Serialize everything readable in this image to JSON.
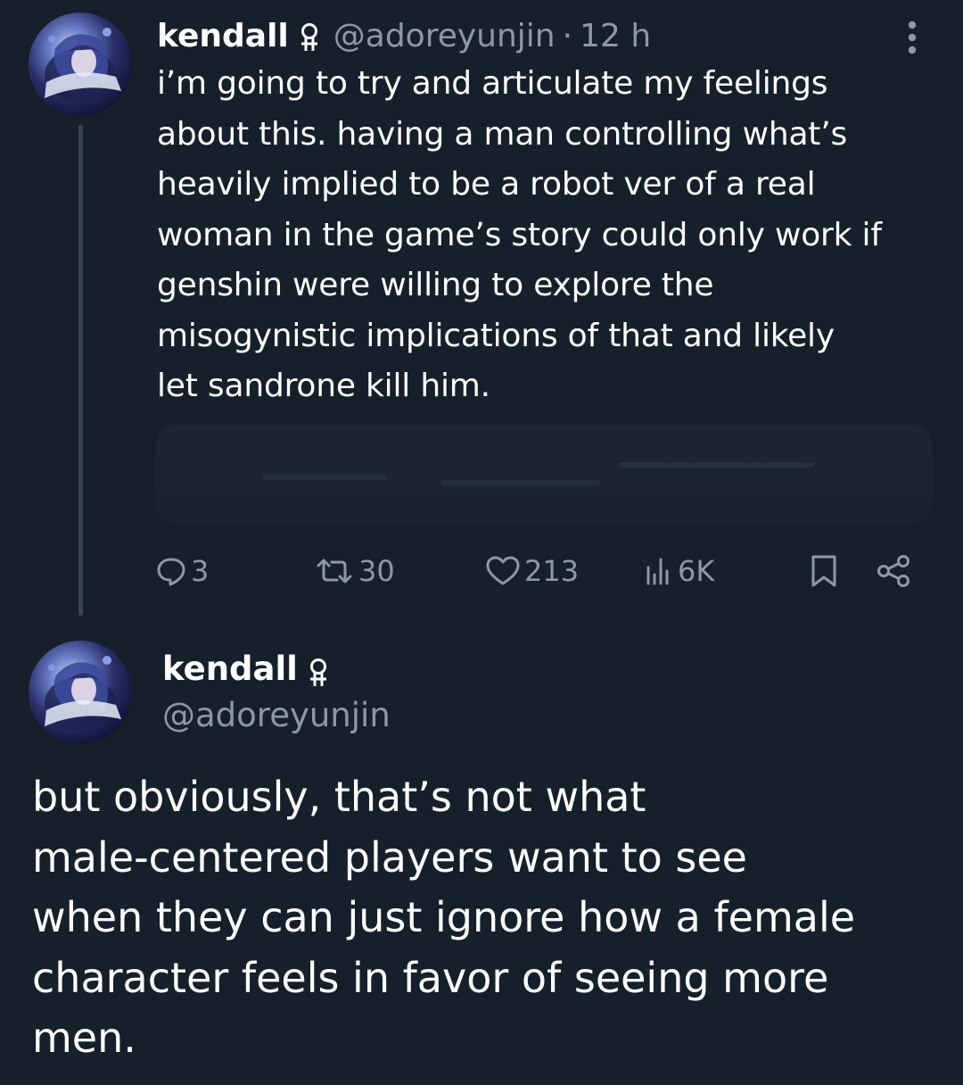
{
  "colors": {
    "background": "#16202a",
    "text_primary": "#ffffff",
    "text_secondary": "#8b98a5",
    "thread_line": "#37444f"
  },
  "tweet": {
    "author_name": "kendall",
    "author_badge_icon": "double-venus-icon",
    "handle": "@adoreyunjin",
    "separator": "·",
    "time": "12 h",
    "more_icon": "more-vertical-icon",
    "text": "i’m going to try and articulate my feelings\nabout this. having a man controlling what’s\nheavily implied to be a robot ver of a real\nwoman in the game’s story could only work if\ngenshin were willing to explore the\nmisogynistic implications of that and likely\nlet sandrone kill him.",
    "actions": {
      "reply": {
        "icon": "reply-icon",
        "count": "3"
      },
      "retweet": {
        "icon": "retweet-icon",
        "count": "30"
      },
      "like": {
        "icon": "heart-icon",
        "count": "213"
      },
      "views": {
        "icon": "views-icon",
        "count": "6K"
      },
      "bookmark": {
        "icon": "bookmark-icon"
      },
      "share": {
        "icon": "share-icon"
      }
    }
  },
  "reply_tweet": {
    "author_name": "kendall",
    "author_badge_icon": "double-venus-icon",
    "handle": "@adoreyunjin",
    "text": "but obviously, that’s not what\nmale-centered players want to see\nwhen they can just ignore how a female\ncharacter feels in favor of seeing more\nmen."
  }
}
